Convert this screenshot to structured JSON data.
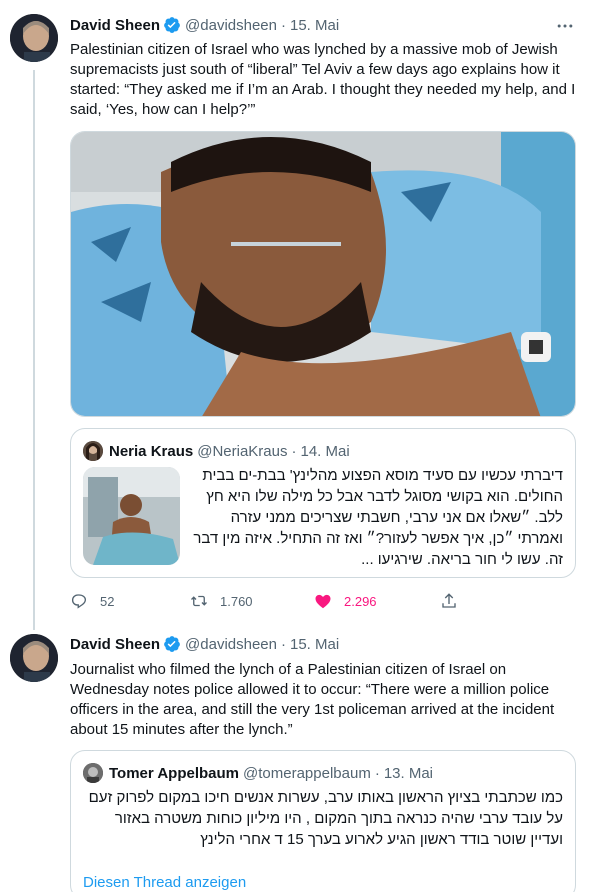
{
  "tweet1": {
    "author_name": "David Sheen",
    "author_handle": "@davidsheen",
    "separator": "·",
    "date": "15. Mai",
    "text": "Palestinian citizen of Israel who was lynched by a massive mob of Jewish supremacists just south of “liberal” Tel Aviv a few days ago explains how it started: “They asked me if I’m an Arab. I thought they needed my help, and I said, ‘Yes, how can I help?’”",
    "quote": {
      "author_name": "Neria Kraus",
      "author_handle": "@NeriaKraus",
      "separator": "·",
      "date": "14. Mai",
      "text": "דיברתי עכשיו עם סעיד מוסא הפצוע מהלינץ' בבת-ים בבית החולים. הוא בקושי מסוגל לדבר אבל כל מילה שלו היא חץ ללב. ״שאלו אם אני ערבי, חשבתי שצריכים ממני עזרה ואמרתי ״כן, איך אפשר לעזור?״ ואז זה התחיל. איזה מין דבר זה. עשו לי חור בריאה. שירגיעו ..."
    },
    "stats": {
      "replies": "52",
      "retweets": "1.760",
      "likes": "2.296"
    }
  },
  "tweet2": {
    "author_name": "David Sheen",
    "author_handle": "@davidsheen",
    "separator": "·",
    "date": "15. Mai",
    "text": "Journalist who filmed the lynch of a Palestinian citizen of Israel on Wednesday notes police allowed it to occur: “There were a million police officers in the area, and still the very 1st policeman arrived at the incident about 15 minutes after the lynch.”",
    "quote": {
      "author_name": "Tomer Appelbaum",
      "author_handle": "@tomerappelbaum",
      "separator": "·",
      "date": "13. Mai",
      "text": "כמו שכתבתי בציוץ הראשון באותו ערב, עשרות אנשים חיכו במקום לפרוק זעם על עובד ערבי שהיה כנראה בתוך המקום , היו מיליון כוחות משטרה באזור ועדיין שוטר בודד ראשון הגיע לארוע בערך 15 ד אחרי הלינץ"
    }
  },
  "show_thread_label": "Diesen Thread anzeigen",
  "colors": {
    "accent": "#1d9bf0",
    "like": "#f91880",
    "muted": "#536471",
    "border": "#cfd9de"
  },
  "icons": [
    "verified-badge-icon",
    "more-options-icon",
    "reply-icon",
    "retweet-icon",
    "like-icon",
    "share-icon"
  ]
}
